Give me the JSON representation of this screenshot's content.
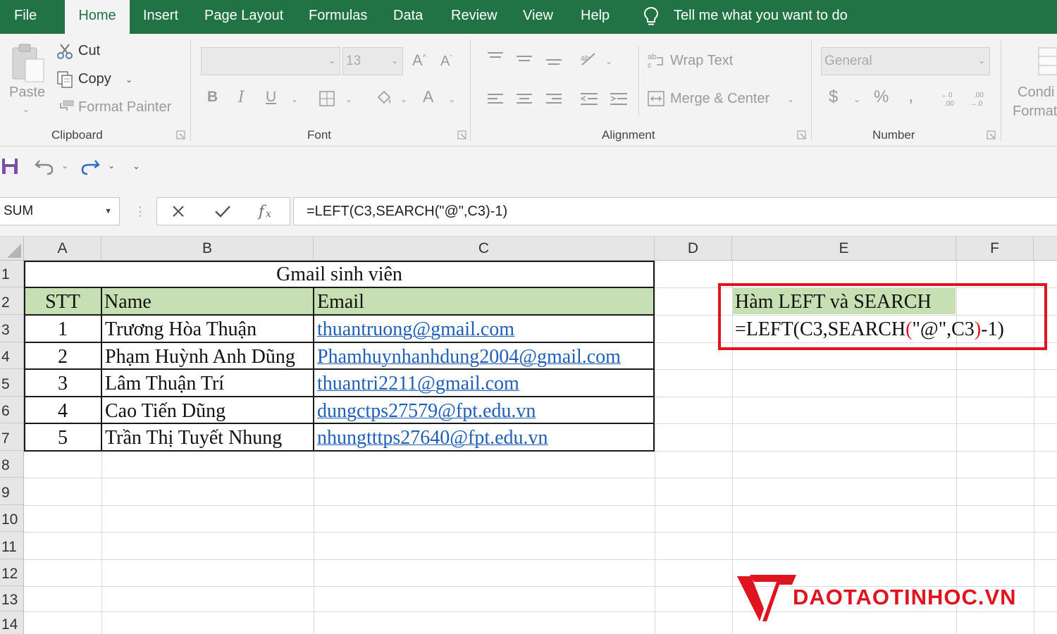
{
  "menu": {
    "tabs": [
      "File",
      "Home",
      "Insert",
      "Page Layout",
      "Formulas",
      "Data",
      "Review",
      "View",
      "Help"
    ],
    "active_tab": "Home",
    "tell_me": "Tell me what you want to do"
  },
  "ribbon": {
    "clipboard": {
      "paste": "Paste",
      "cut": "Cut",
      "copy": "Copy",
      "format_painter": "Format Painter",
      "label": "Clipboard"
    },
    "font": {
      "font_name": "",
      "font_size": "13",
      "label": "Font"
    },
    "alignment": {
      "wrap_text": "Wrap Text",
      "merge_center": "Merge & Center",
      "label": "Alignment"
    },
    "number": {
      "format": "General",
      "label": "Number"
    },
    "styles": {
      "conditional_line1": "Condi",
      "conditional_line2": "Format"
    }
  },
  "formula_bar": {
    "name_box": "SUM",
    "formula": "=LEFT(C3,SEARCH(\"@\",C3)-1)"
  },
  "sheet": {
    "columns": [
      "A",
      "B",
      "C",
      "D",
      "E",
      "F"
    ],
    "rows": [
      "1",
      "2",
      "3",
      "4",
      "5",
      "6",
      "7",
      "8",
      "9",
      "10",
      "11",
      "12",
      "13",
      "14"
    ],
    "title": "Gmail sinh viên",
    "headers": {
      "stt": "STT",
      "name": "Name",
      "email": "Email"
    },
    "data": [
      {
        "stt": "1",
        "name": "Trương Hòa Thuận",
        "email": "thuantruong@gmail.com"
      },
      {
        "stt": "2",
        "name": "Phạm Huỳnh Anh Dũng",
        "email": "Phamhuynhanhdung2004@gmail.com"
      },
      {
        "stt": "3",
        "name": "Lâm Thuận Trí",
        "email": "thuantri2211@gmail.com"
      },
      {
        "stt": "4",
        "name": "Cao Tiến Dũng",
        "email": "dungctps27579@fpt.edu.vn"
      },
      {
        "stt": "5",
        "name": "Trần Thị Tuyết Nhung",
        "email": "nhungtttps27640@fpt.edu.vn"
      }
    ],
    "callout": {
      "label": "Hàm LEFT và SEARCH",
      "formula_pre": "=LEFT(C3,SEARCH",
      "paren_open": "(",
      "formula_mid": "\"@\",C3",
      "paren_close": ")",
      "formula_post": "-1)"
    }
  },
  "watermark": {
    "text": "DAOTAOTINHOC.VN"
  },
  "colors": {
    "excel_green": "#217346",
    "header_fill": "#c6e0b4",
    "callout_border": "#e0141e",
    "link_blue": "#1f5fb7",
    "brand_red": "#e0141e"
  }
}
